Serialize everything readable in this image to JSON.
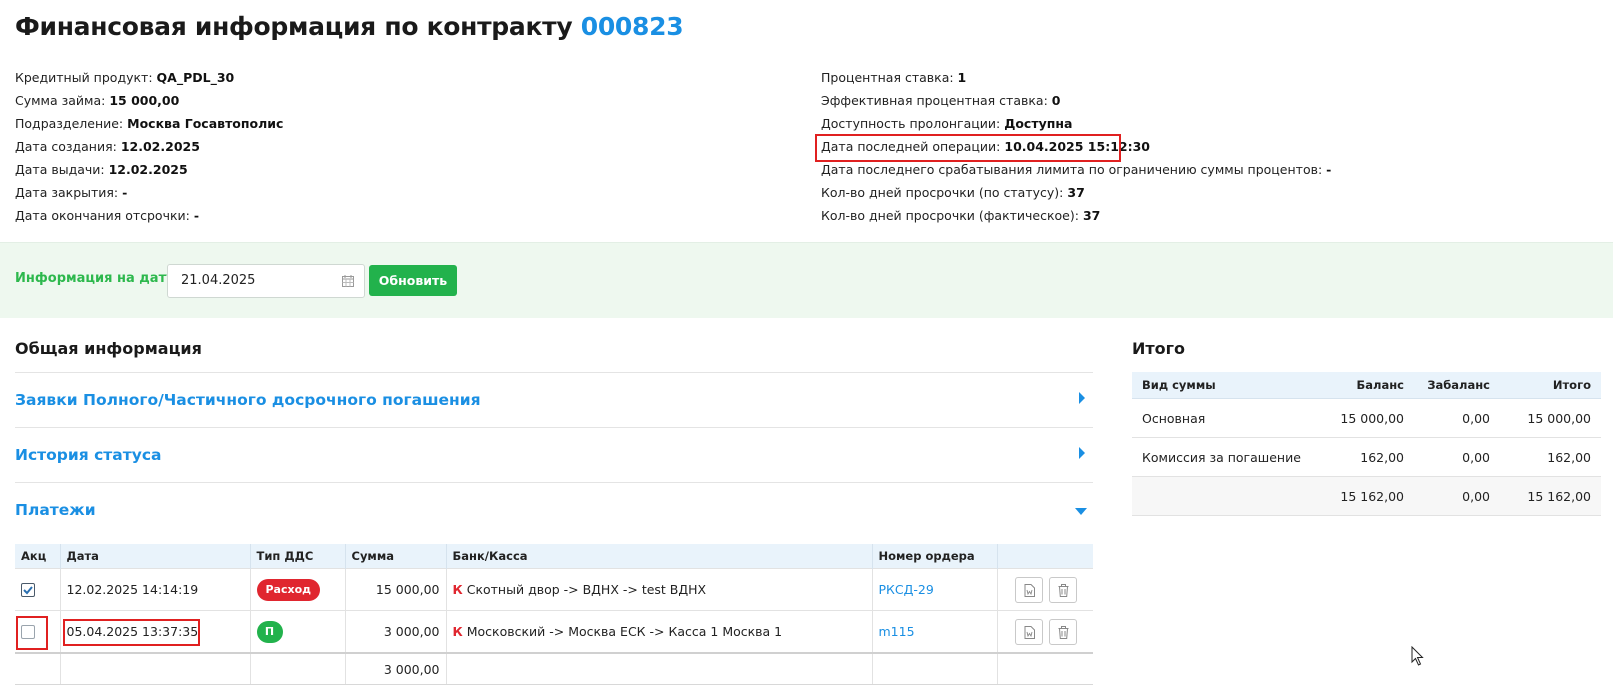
{
  "header": {
    "title_prefix": "Финансовая информация по контракту",
    "contract_number": "000823"
  },
  "info_left": [
    {
      "label": "Кредитный продукт:",
      "value": "QA_PDL_30"
    },
    {
      "label": "Сумма займа:",
      "value": "15 000,00"
    },
    {
      "label": "Подразделение:",
      "value": "Москва Госавтополис"
    },
    {
      "label": "Дата создания:",
      "value": "12.02.2025"
    },
    {
      "label": "Дата выдачи:",
      "value": "12.02.2025"
    },
    {
      "label": "Дата закрытия:",
      "value": "-"
    },
    {
      "label": "Дата окончания отсрочки:",
      "value": "-"
    }
  ],
  "info_right": [
    {
      "label": "Процентная ставка:",
      "value": "1"
    },
    {
      "label": "Эффективная процентная ставка:",
      "value": "0"
    },
    {
      "label": "Доступность пролонгации:",
      "value": "Доступна"
    },
    {
      "label": "Дата последней операции:",
      "value": "10.04.2025 15:12:30"
    },
    {
      "label": "Дата последнего срабатывания лимита по ограничению суммы процентов:",
      "value": "-"
    },
    {
      "label": "Кол-во дней просрочки (по статусу):",
      "value": "37"
    },
    {
      "label": "Кол-во дней просрочки (фактическое):",
      "value": "37"
    }
  ],
  "date_filter": {
    "label": "Информация на дату",
    "value": "21.04.2025",
    "button": "Обновить"
  },
  "general": {
    "title": "Общая информация",
    "sections": [
      {
        "label": "Заявки Полного/Частичного досрочного погашения",
        "expanded": false
      },
      {
        "label": "История статуса",
        "expanded": false
      },
      {
        "label": "Платежи",
        "expanded": true
      }
    ]
  },
  "payments": {
    "columns": [
      "Акц",
      "Дата",
      "Тип ДДС",
      "Сумма",
      "Банк/Касса",
      "Номер ордера",
      ""
    ],
    "rows": [
      {
        "checked": true,
        "date": "12.02.2025 14:14:19",
        "type": "Расход",
        "type_color": "#e0262f",
        "amount": "15 000,00",
        "bank_mark": "К",
        "bank": "Скотный двор -> ВДНХ -> test ВДНХ",
        "order": "РКСД-29"
      },
      {
        "checked": false,
        "date": "05.04.2025 13:37:35",
        "type": "П",
        "type_color": "#22b24c",
        "amount": "3 000,00",
        "bank_mark": "К",
        "bank": "Московский -> Москва ЕСК -> Касса 1 Москва 1",
        "order": "m115"
      }
    ],
    "total_amount": "3 000,00"
  },
  "totals": {
    "title": "Итого",
    "columns": [
      "Вид суммы",
      "Баланс",
      "Забаланс",
      "Итого"
    ],
    "rows": [
      {
        "kind": "Основная",
        "balance": "15 000,00",
        "offbalance": "0,00",
        "total": "15 000,00"
      },
      {
        "kind": "Комиссия за погашение",
        "balance": "162,00",
        "offbalance": "0,00",
        "total": "162,00"
      }
    ],
    "sum": {
      "balance": "15 162,00",
      "offbalance": "0,00",
      "total": "15 162,00"
    }
  },
  "colors": {
    "accent_blue": "#1a8fe3",
    "accent_green": "#22b24c",
    "danger_red": "#e0262f",
    "highlight": "#e02020"
  }
}
